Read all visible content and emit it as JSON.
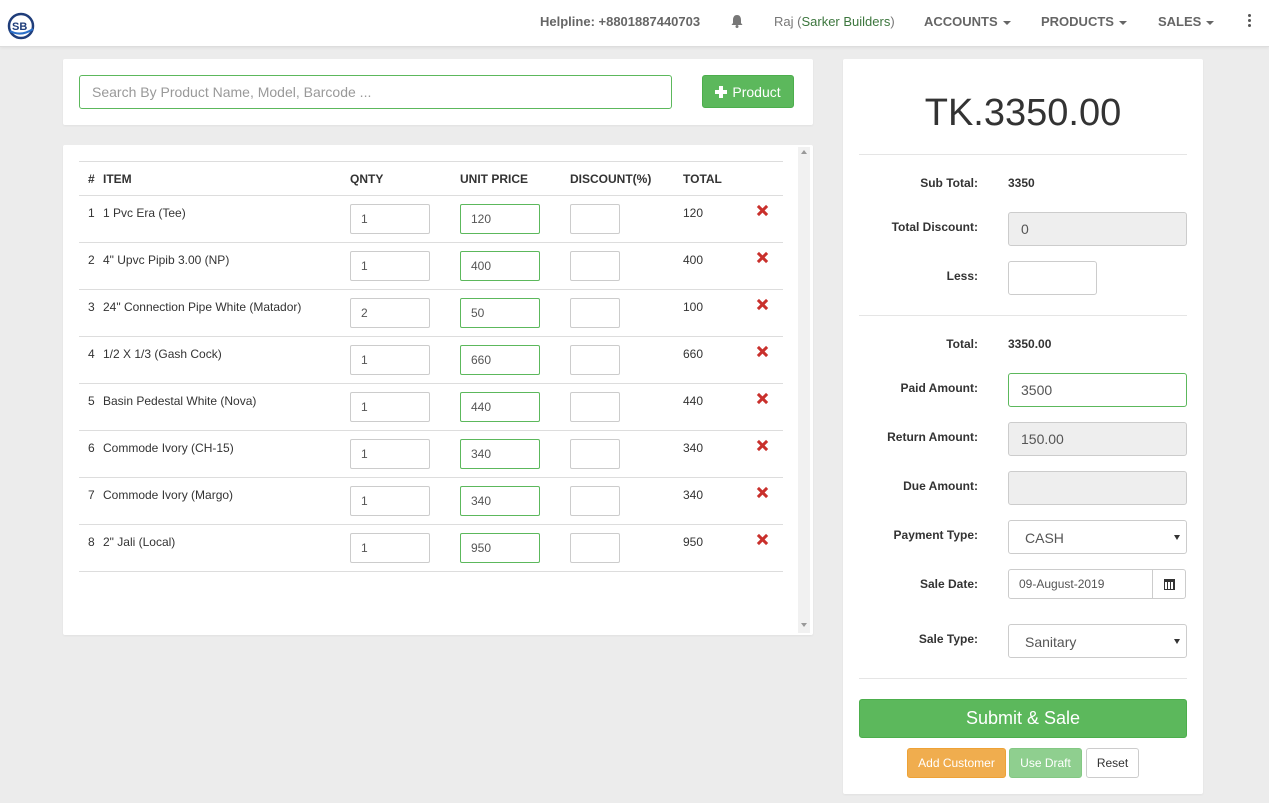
{
  "navbar": {
    "helpline": "Helpline: +8801887440703",
    "user_name": "Raj",
    "company": "Sarker Builders",
    "menus": [
      {
        "label": "ACCOUNTS"
      },
      {
        "label": "PRODUCTS"
      },
      {
        "label": "SALES"
      }
    ],
    "icons": {
      "bell": "bell-icon",
      "more": "kebab-icon",
      "logo": "sb-logo"
    }
  },
  "search": {
    "placeholder": "Search By Product Name, Model, Barcode ...",
    "add_button_label": "Product"
  },
  "table": {
    "headers": {
      "idx": "#",
      "item": "ITEM",
      "qty": "QNTY",
      "unit_price": "UNIT PRICE",
      "discount": "DISCOUNT(%)",
      "total": "TOTAL"
    },
    "rows": [
      {
        "idx": "1",
        "item": "1 Pvc Era (Tee)",
        "qty": "1",
        "price": "120",
        "discount": "",
        "total": "120"
      },
      {
        "idx": "2",
        "item": "4\" Upvc Pipib 3.00 (NP)",
        "qty": "1",
        "price": "400",
        "discount": "",
        "total": "400"
      },
      {
        "idx": "3",
        "item": "24\" Connection Pipe White (Matador)",
        "qty": "2",
        "price": "50",
        "discount": "",
        "total": "100"
      },
      {
        "idx": "4",
        "item": "1/2 X 1/3 (Gash Cock)",
        "qty": "1",
        "price": "660",
        "discount": "",
        "total": "660"
      },
      {
        "idx": "5",
        "item": "Basin Pedestal White (Nova)",
        "qty": "1",
        "price": "440",
        "discount": "",
        "total": "440"
      },
      {
        "idx": "6",
        "item": "Commode Ivory (CH-15)",
        "qty": "1",
        "price": "340",
        "discount": "",
        "total": "340"
      },
      {
        "idx": "7",
        "item": "Commode Ivory (Margo)",
        "qty": "1",
        "price": "340",
        "discount": "",
        "total": "340"
      },
      {
        "idx": "8",
        "item": "2\" Jali (Local)",
        "qty": "1",
        "price": "950",
        "discount": "",
        "total": "950"
      }
    ]
  },
  "summary": {
    "grand_total": "TK.3350.00",
    "sub_total_label": "Sub Total:",
    "sub_total": "3350",
    "total_discount_label": "Total Discount:",
    "total_discount": "0",
    "less_label": "Less:",
    "less": "",
    "total_label": "Total:",
    "total": "3350.00",
    "paid_label": "Paid Amount:",
    "paid": "3500",
    "return_label": "Return Amount:",
    "return": "150.00",
    "due_label": "Due Amount:",
    "due": "",
    "payment_type_label": "Payment Type:",
    "payment_type": "CASH",
    "sale_date_label": "Sale Date:",
    "sale_date": "09-August-2019",
    "sale_type_label": "Sale Type:",
    "sale_type": "Sanitary"
  },
  "actions": {
    "submit": "Submit & Sale",
    "add_customer": "Add Customer",
    "use_draft": "Use Draft",
    "reset": "Reset"
  },
  "colors": {
    "success": "#5cb85c",
    "warning": "#f0ad4e",
    "danger": "#c9302c",
    "company_text": "#3c763d"
  }
}
